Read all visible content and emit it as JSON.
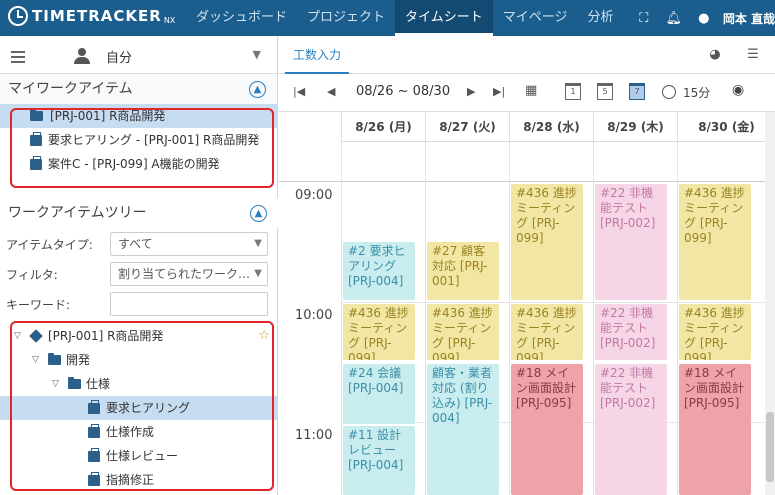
{
  "app": {
    "logo": "TIMETRACKER",
    "logo_suffix": "NX"
  },
  "nav": [
    "ダッシュボード",
    "プロジェクト",
    "タイムシート",
    "マイページ",
    "分析"
  ],
  "user": "岡本 直哉",
  "left": {
    "self_label": "自分",
    "my_work_items_title": "マイワークアイテム",
    "my_work_items": [
      "[PRJ-001] R商品開発",
      "要求ヒアリング - [PRJ-001] R商品開発",
      "案件C - [PRJ-099] A機能の開発"
    ],
    "tree_title": "ワークアイテムツリー",
    "filters": {
      "item_type_label": "アイテムタイプ:",
      "item_type_value": "すべて",
      "filter_label": "フィルタ:",
      "filter_value": "割り当てられたワーク…",
      "keyword_label": "キーワード:",
      "keyword_value": ""
    },
    "tree": [
      "[PRJ-001] R商品開発",
      "開発",
      "仕様",
      "要求ヒアリング",
      "仕様作成",
      "仕様レビュー",
      "指摘修正"
    ]
  },
  "right": {
    "tab": "工数入力",
    "date_range": "08/26 ~ 08/30",
    "calendar_buttons": [
      "1",
      "5",
      "7"
    ],
    "interval": "15分",
    "days": [
      "8/26 (月)",
      "8/27 (火)",
      "8/28 (水)",
      "8/29 (木)",
      "8/30 (金)"
    ],
    "hours": [
      "09:00",
      "10:00",
      "11:00"
    ],
    "events": [
      "#436 進捗ミーティング [PRJ-099]",
      "#22 非機能テスト [PRJ-002]",
      "#436 進捗ミーティング [PRJ-099]",
      "#2 要求ヒアリング [PRJ-004]",
      "#27 顧客対応 [PRJ-001]",
      "#436 進捗ミーティング [PRJ-099]",
      "#436 進捗ミーティング [PRJ-099]",
      "#436 進捗ミーティング [PRJ-099]",
      "#22 非機能テスト [PRJ-002]",
      "#436 進捗ミーティング [PRJ-099]",
      "#24 会議 [PRJ-004]",
      "顧客・業者対応 (割り込み) [PRJ-004]",
      "#18 メイン画面設計 [PRJ-095]",
      "#22 非機能テスト [PRJ-002]",
      "#18 メイン画面設計 [PRJ-095]",
      "#11 設計レビュー [PRJ-004]"
    ]
  },
  "colors": {
    "header": "#1b5e8e",
    "accent": "#2a7fbf",
    "highlight_box": "#e0262c",
    "event_teal": "#c9ecef",
    "event_yellow": "#f2e6a4",
    "event_pink": "#f6d6e6",
    "event_red": "#eda3a9"
  }
}
